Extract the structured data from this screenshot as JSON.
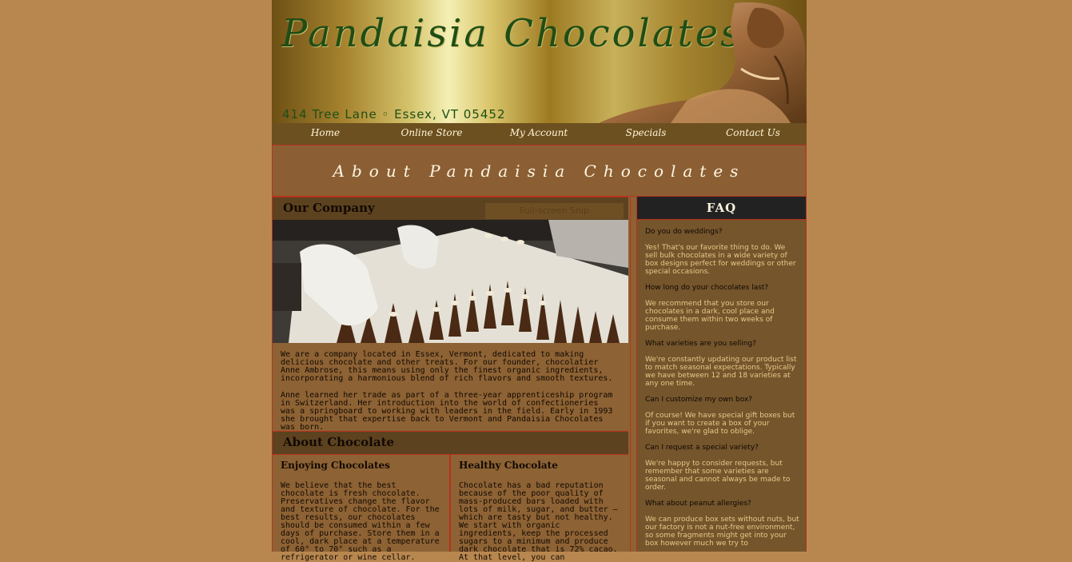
{
  "header": {
    "brand": "Pandaisia Chocolates",
    "address": "414 Tree Lane ◦ Essex, VT 05452"
  },
  "nav": {
    "items": [
      {
        "label": "Home"
      },
      {
        "label": "Online Store"
      },
      {
        "label": "My Account"
      },
      {
        "label": "Specials"
      },
      {
        "label": "Contact Us"
      }
    ]
  },
  "banner": {
    "title": "About Pandaisia Chocolates"
  },
  "company": {
    "heading": "Our Company",
    "snip_overlay": "Full-screen Snip",
    "paragraphs": [
      "We are a company located in Essex, Vermont, dedicated to making delicious chocolate and other treats. For our founder, chocolatier Anne Ambrose, this means using only the finest organic ingredients, incorporating a harmonious blend of rich flavors and smooth textures.",
      "Anne learned her trade as part of a three-year apprenticeship program in Switzerland. Her introduction into the world of confectioneries was a springboard to working with leaders in the field. Early in 1993 she brought that expertise back to Vermont and Pandaisia Chocolates was born."
    ]
  },
  "about_chocolate": {
    "heading": "About Chocolate",
    "columns": [
      {
        "title": "Enjoying Chocolates",
        "text": "We believe that the best chocolate is fresh chocolate. Preservatives change the flavor and texture of chocolate. For the best results, our chocolates should be consumed within a few days of purchase. Store them in a cool, dark place at a temperature of 60° to 70° such as a refrigerator or wine cellar."
      },
      {
        "title": "Healthy Chocolate",
        "text": "Chocolate has a bad reputation because of the poor quality of mass-produced bars loaded with lots of milk, sugar, and butter — which are tasty but not healthy. We start with organic ingredients, keep the processed sugars to a minimum and produce dark chocolate that is 72% cacao. At that level, you can"
      }
    ]
  },
  "faq": {
    "heading": "FAQ",
    "items": [
      {
        "q": "Do you do weddings?",
        "a": "Yes! That's our favorite thing to do. We sell bulk chocolates in a wide variety of box designs perfect for weddings or other special occasions."
      },
      {
        "q": "How long do your chocolates last?",
        "a": "We recommend that you store our chocolates in a dark, cool place and consume them within two weeks of purchase."
      },
      {
        "q": "What varieties are you selling?",
        "a": "We're constantly updating our product list to match seasonal expectations. Typically we have between 12 and 18 varieties at any one time."
      },
      {
        "q": "Can I customize my own box?",
        "a": "Of course! We have special gift boxes but if you want to create a box of your favorites, we're glad to oblige."
      },
      {
        "q": "Can I request a special variety?",
        "a": "We're happy to consider requests, but remember that some varieties are seasonal and cannot always be made to order."
      },
      {
        "q": "What about peanut allergies?",
        "a": "We can produce box sets without nuts, but our factory is not a nut-free environment, so some fragments might get into your box however much we try to"
      }
    ]
  }
}
